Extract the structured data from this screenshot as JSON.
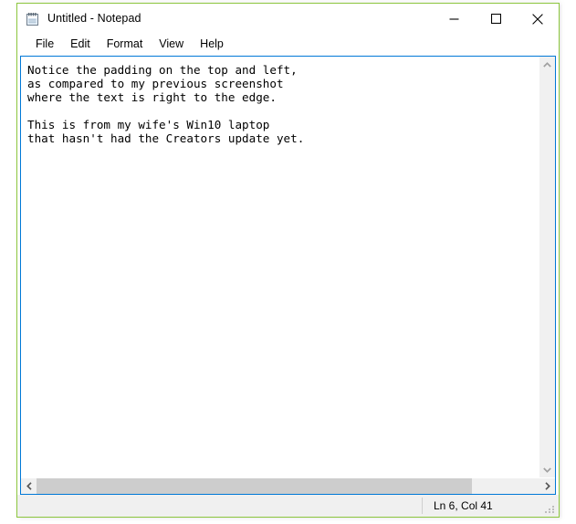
{
  "window": {
    "title": "Untitled - Notepad",
    "icon": "notepad-icon",
    "accent_border_color": "#8cc63e",
    "editor_border_color": "#0078d7",
    "controls": {
      "minimize_label": "Minimize",
      "maximize_label": "Maximize",
      "close_label": "Close"
    }
  },
  "menu": {
    "items": [
      {
        "label": "File"
      },
      {
        "label": "Edit"
      },
      {
        "label": "Format"
      },
      {
        "label": "View"
      },
      {
        "label": "Help"
      }
    ]
  },
  "editor": {
    "text": "Notice the padding on the top and left,\nas compared to my previous screenshot\nwhere the text is right to the edge.\n\nThis is from my wife's Win10 laptop\nthat hasn't had the Creators update yet.",
    "lines": [
      "Notice the padding on the top and left,",
      "as compared to my previous screenshot",
      "where the text is right to the edge.",
      "",
      "This is from my wife's Win10 laptop",
      "that hasn't had the Creators update yet."
    ],
    "background_color": "#ffffff",
    "text_color": "#000000"
  },
  "scrollbars": {
    "vertical": {
      "up_arrow": "chevron-up-icon",
      "down_arrow": "chevron-down-icon",
      "thumb_visible": false
    },
    "horizontal": {
      "left_arrow": "chevron-left-icon",
      "right_arrow": "chevron-right-icon",
      "thumb_visible": true,
      "thumb_width_percent": 86.5,
      "thumb_color": "#cdcdcd"
    }
  },
  "status_bar": {
    "position_text": "Ln 6, Col 41",
    "line": 6,
    "column": 41,
    "background_color": "#f0f0f0"
  }
}
